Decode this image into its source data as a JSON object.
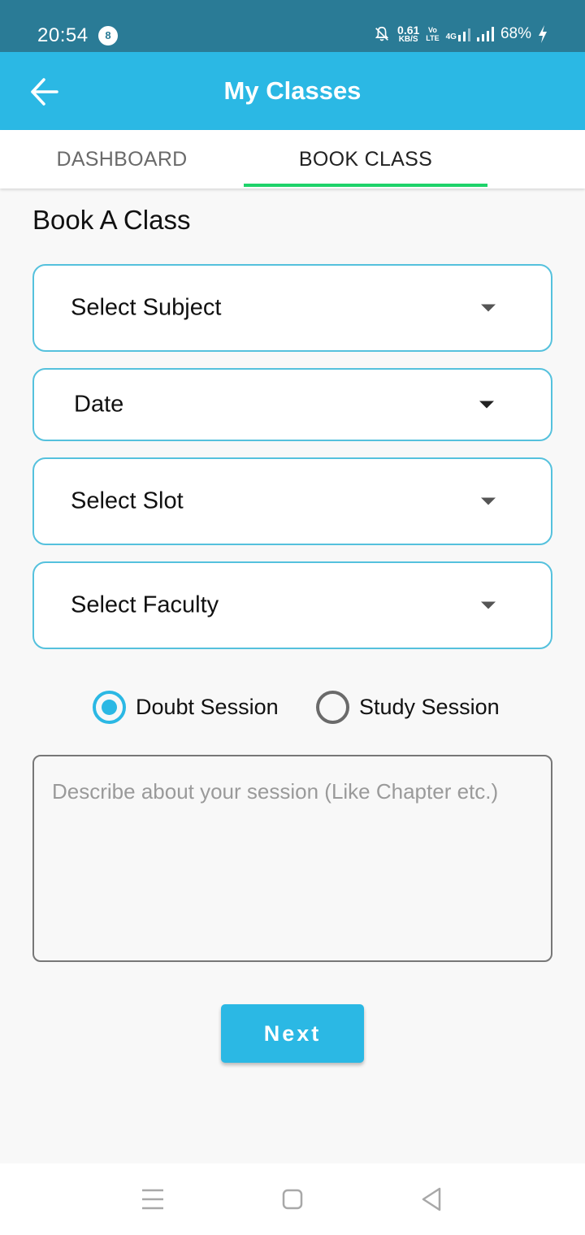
{
  "status_bar": {
    "time": "20:54",
    "notification_count": "8",
    "speed_value": "0.61",
    "speed_unit": "KB/S",
    "volte_top": "Vo",
    "volte_bottom": "LTE",
    "network": "4G",
    "battery": "68%"
  },
  "app_bar": {
    "title": "My Classes",
    "back_icon": "arrow-left-icon"
  },
  "tabs": [
    {
      "label": "DASHBOARD",
      "selected": false
    },
    {
      "label": "BOOK CLASS",
      "selected": true
    }
  ],
  "form": {
    "title": "Book A Class",
    "subject": "Select Subject",
    "date": "Date",
    "slot": "Select Slot",
    "faculty": "Select Faculty",
    "session_types": [
      {
        "label": "Doubt Session",
        "selected": true
      },
      {
        "label": "Study Session",
        "selected": false
      }
    ],
    "description_placeholder": "Describe about your session (Like Chapter etc.)",
    "description_value": "",
    "next_label": "Next"
  },
  "nav_bar": {
    "icons": [
      "menu-icon",
      "home-icon",
      "back-icon"
    ]
  },
  "colors": {
    "status_bar": "#2a7b96",
    "primary": "#2bb8e4",
    "tab_indicator": "#1ed36a",
    "dropdown_border": "#55c1dd"
  }
}
